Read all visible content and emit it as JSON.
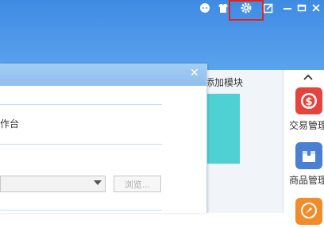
{
  "window_controls": {
    "chat_icon": "chat-bubble-icon",
    "shirt_icon": "skin-icon",
    "settings_icon": "gear-icon",
    "edit_icon": "edit-square-icon",
    "minimize_icon": "minimize-icon",
    "maximize_icon": "maximize-icon",
    "close_icon": "close-icon"
  },
  "main": {
    "add_module_label": "添加模块"
  },
  "right_panel": {
    "scroll_up_icon": "chevron-up-icon",
    "items": [
      {
        "label": "交易管理",
        "icon": "dollar-icon",
        "color": "#e6433d"
      },
      {
        "label": "商品管理",
        "icon": "box-icon",
        "color": "#4a7fd1"
      },
      {
        "label": "",
        "icon": "compass-icon",
        "color": "#f08c2a"
      }
    ]
  },
  "dialog": {
    "close_glyph": "✕",
    "workbench_label": "作台",
    "browse_button": "浏览..."
  },
  "colors": {
    "titlebar": "#4a94e8",
    "highlight": "#e0231c",
    "teal": "#4fd0d2"
  }
}
